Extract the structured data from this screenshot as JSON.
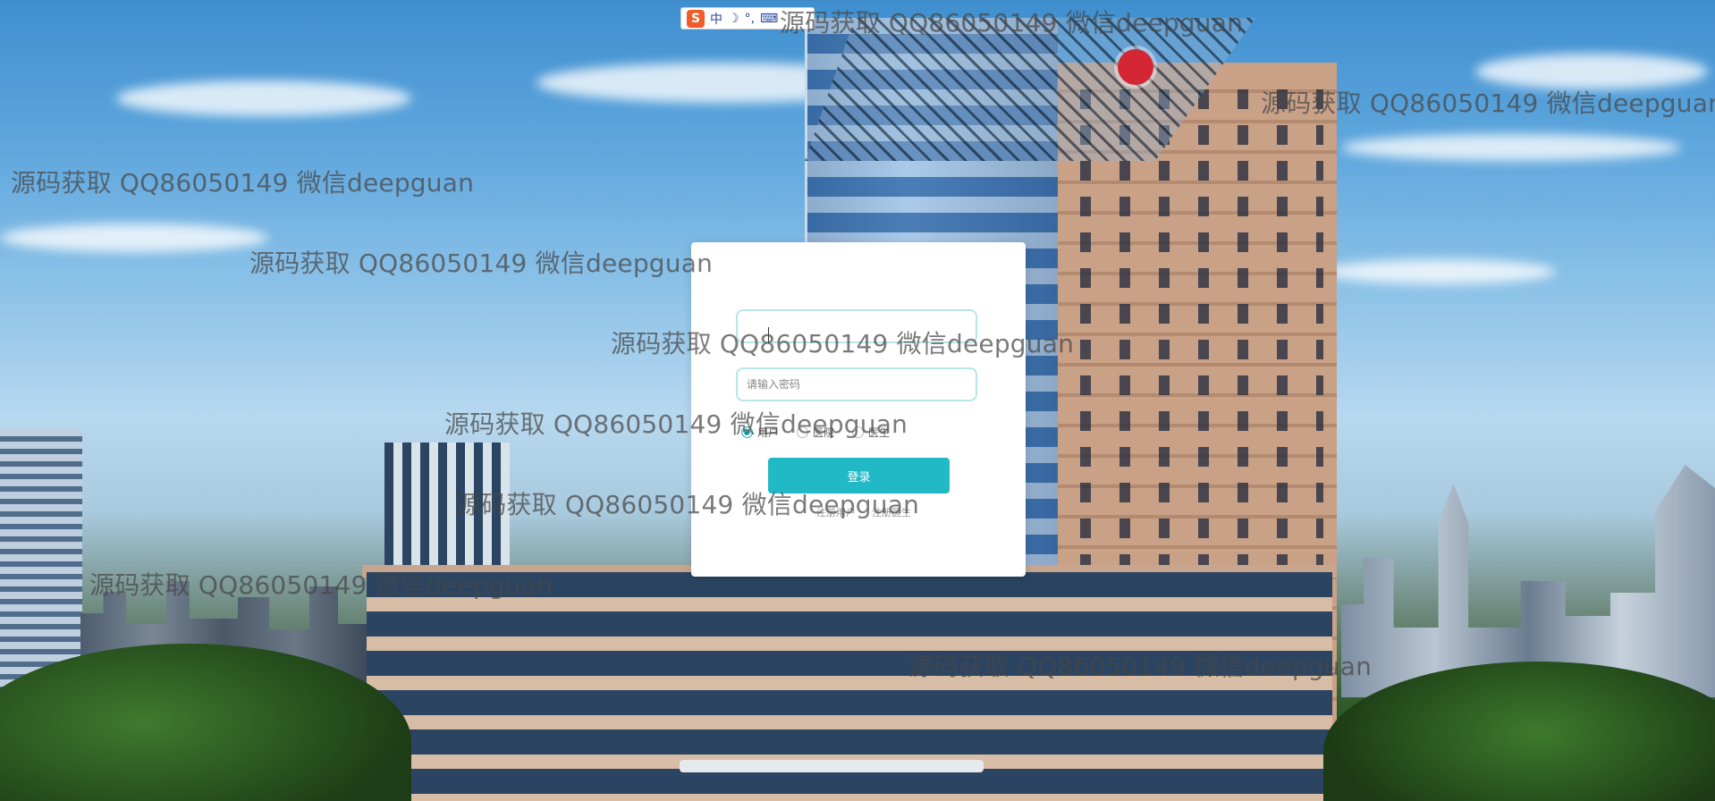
{
  "ime": {
    "logo": "S",
    "items": [
      "中",
      "☽",
      "°,",
      "⌨"
    ]
  },
  "login": {
    "username_placeholder": "",
    "password_placeholder": "请输入密码",
    "roles": [
      {
        "label": "用户",
        "selected": true
      },
      {
        "label": "医院",
        "selected": false
      },
      {
        "label": "医生",
        "selected": false
      }
    ],
    "login_button": "登录",
    "links": {
      "register_user": "注册用户",
      "register_doctor": "注册医生"
    }
  },
  "watermark": {
    "text": "源码获取 QQ86050149 微信deepguan"
  },
  "colors": {
    "accent": "#22b9c6",
    "input_border": "#b9e6ea",
    "watermark": "#464646"
  }
}
